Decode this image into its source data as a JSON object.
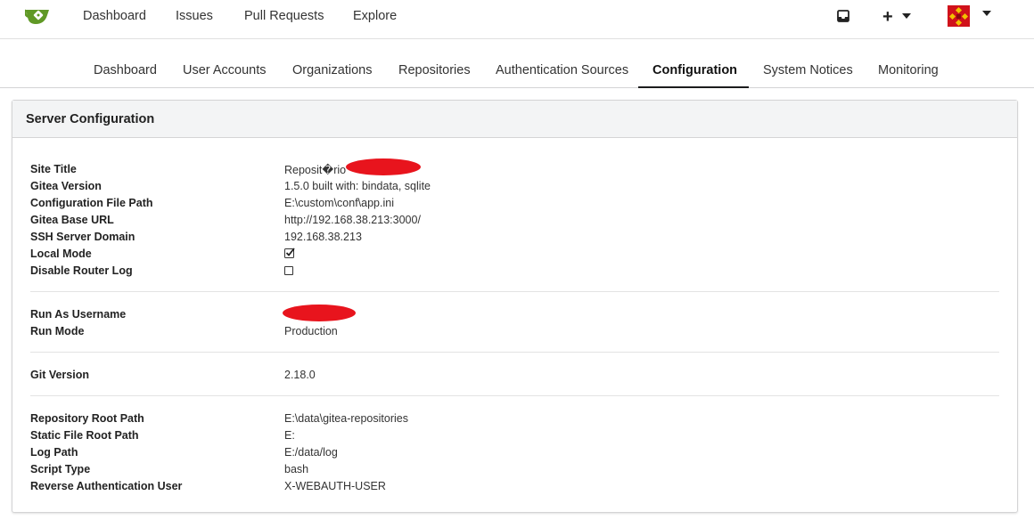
{
  "topnav": {
    "items": [
      "Dashboard",
      "Issues",
      "Pull Requests",
      "Explore"
    ],
    "plus_label": "+"
  },
  "admin_tabs": {
    "items": [
      "Dashboard",
      "User Accounts",
      "Organizations",
      "Repositories",
      "Authentication Sources",
      "Configuration",
      "System Notices",
      "Monitoring"
    ],
    "active": "Configuration"
  },
  "panel": {
    "title": "Server Configuration",
    "groups": [
      [
        {
          "label": "Site Title",
          "value": "Reposit�rio"
        },
        {
          "label": "Gitea Version",
          "value": "1.5.0 built with: bindata, sqlite"
        },
        {
          "label": "Configuration File Path",
          "value": "E:\\custom\\conf\\app.ini"
        },
        {
          "label": "Gitea Base URL",
          "value": "http://192.168.38.213:3000/"
        },
        {
          "label": "SSH Server Domain",
          "value": "192.168.38.213"
        },
        {
          "label": "Local Mode",
          "value": "",
          "checked": true
        },
        {
          "label": "Disable Router Log",
          "value": "",
          "checked": false
        }
      ],
      [
        {
          "label": "Run As Username",
          "value": ""
        },
        {
          "label": "Run Mode",
          "value": "Production"
        }
      ],
      [
        {
          "label": "Git Version",
          "value": "2.18.0"
        }
      ],
      [
        {
          "label": "Repository Root Path",
          "value": "E:\\data\\gitea-repositories"
        },
        {
          "label": "Static File Root Path",
          "value": "E:"
        },
        {
          "label": "Log Path",
          "value": "E:/data/log"
        },
        {
          "label": "Script Type",
          "value": "bash"
        },
        {
          "label": "Reverse Authentication User",
          "value": "X-WEBAUTH-USER"
        }
      ]
    ]
  },
  "icons": {
    "logo": "gitea-logo-icon",
    "inbox": "inbox-icon",
    "plus": "plus-icon",
    "avatar": "user-avatar",
    "check": "check-icon",
    "checkbox": "empty-checkbox-icon"
  },
  "colors": {
    "logo_green": "#609926",
    "redaction": "#e8141d",
    "avatar_red": "#d0121b",
    "avatar_yellow": "#f2c200"
  }
}
